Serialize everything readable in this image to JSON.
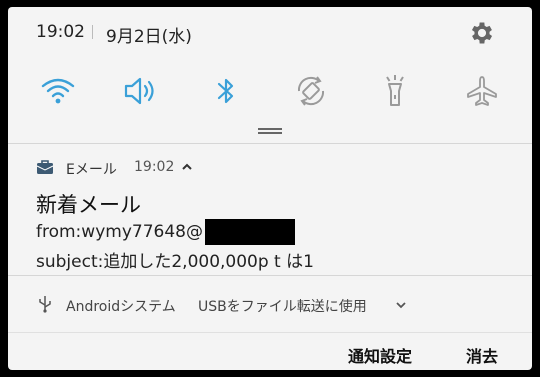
{
  "status": {
    "time": "19:02",
    "date": "9月2日(水)"
  },
  "quick_settings": [
    {
      "name": "wifi",
      "color": "#3aa0d8"
    },
    {
      "name": "sound",
      "color": "#3aa0d8"
    },
    {
      "name": "bluetooth",
      "color": "#3aa0d8"
    },
    {
      "name": "auto-rotate",
      "color": "#9a9a9a"
    },
    {
      "name": "flashlight",
      "color": "#9a9a9a"
    },
    {
      "name": "airplane-mode",
      "color": "#9a9a9a"
    }
  ],
  "notification": {
    "app_name": "Eメール",
    "time": "19:02",
    "title": "新着メール",
    "from_line": "from:wymy77648@",
    "subject_line": "subject:追加した2,000,000p t は1"
  },
  "system_notification": {
    "app_name": "Androidシステム",
    "text": "USBをファイル転送に使用"
  },
  "actions": {
    "settings_label": "通知設定",
    "dismiss_label": "消去"
  }
}
